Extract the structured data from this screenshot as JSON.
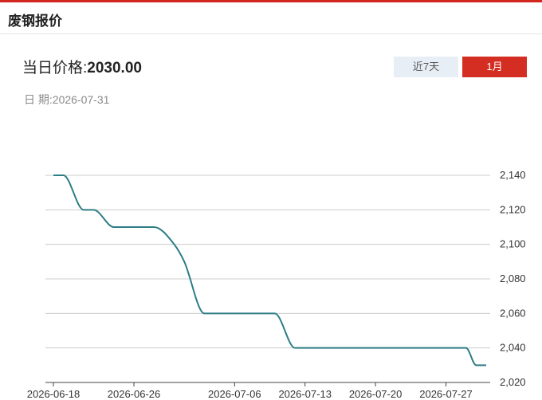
{
  "header": {
    "title": "废钢报价"
  },
  "price": {
    "label": "当日价格:",
    "value": "2030.00"
  },
  "date": {
    "label": "日 期:",
    "value": "2026-07-31"
  },
  "tabs": [
    {
      "label": "近7天",
      "active": false
    },
    {
      "label": "1月",
      "active": true
    }
  ],
  "colors": {
    "accent": "#d0261e",
    "line": "#2d7d85",
    "grid": "#cccccc",
    "inactive_tab": "#e8eef6"
  },
  "chart_data": {
    "type": "line",
    "x_ticks": [
      "2026-06-18",
      "2026-06-26",
      "2026-07-06",
      "2026-07-13",
      "2026-07-20",
      "2026-07-27"
    ],
    "y_ticks": [
      "2,020",
      "2,040",
      "2,060",
      "2,080",
      "2,100",
      "2,120",
      "2,140"
    ],
    "ylim": [
      2020,
      2140
    ],
    "y_axis_side": "right",
    "grid": true,
    "series": [
      {
        "values": [
          [
            "2026-06-18",
            2140
          ],
          [
            "2026-06-19",
            2140
          ],
          [
            "2026-06-21",
            2120
          ],
          [
            "2026-06-22",
            2120
          ],
          [
            "2026-06-24",
            2110
          ],
          [
            "2026-06-25",
            2110
          ],
          [
            "2026-06-26",
            2110
          ],
          [
            "2026-06-27",
            2110
          ],
          [
            "2026-06-28",
            2110
          ],
          [
            "2026-06-30",
            2100
          ],
          [
            "2026-07-01",
            2090
          ],
          [
            "2026-07-03",
            2060
          ],
          [
            "2026-07-04",
            2060
          ],
          [
            "2026-07-05",
            2060
          ],
          [
            "2026-07-06",
            2060
          ],
          [
            "2026-07-07",
            2060
          ],
          [
            "2026-07-08",
            2060
          ],
          [
            "2026-07-09",
            2060
          ],
          [
            "2026-07-10",
            2060
          ],
          [
            "2026-07-12",
            2040
          ],
          [
            "2026-07-13",
            2040
          ],
          [
            "2026-07-14",
            2040
          ],
          [
            "2026-07-15",
            2040
          ],
          [
            "2026-07-16",
            2040
          ],
          [
            "2026-07-17",
            2040
          ],
          [
            "2026-07-18",
            2040
          ],
          [
            "2026-07-19",
            2040
          ],
          [
            "2026-07-20",
            2040
          ],
          [
            "2026-07-21",
            2040
          ],
          [
            "2026-07-22",
            2040
          ],
          [
            "2026-07-23",
            2040
          ],
          [
            "2026-07-24",
            2040
          ],
          [
            "2026-07-25",
            2040
          ],
          [
            "2026-07-26",
            2040
          ],
          [
            "2026-07-27",
            2040
          ],
          [
            "2026-07-28",
            2040
          ],
          [
            "2026-07-29",
            2040
          ],
          [
            "2026-07-30",
            2030
          ],
          [
            "2026-07-31",
            2030
          ]
        ]
      }
    ]
  }
}
